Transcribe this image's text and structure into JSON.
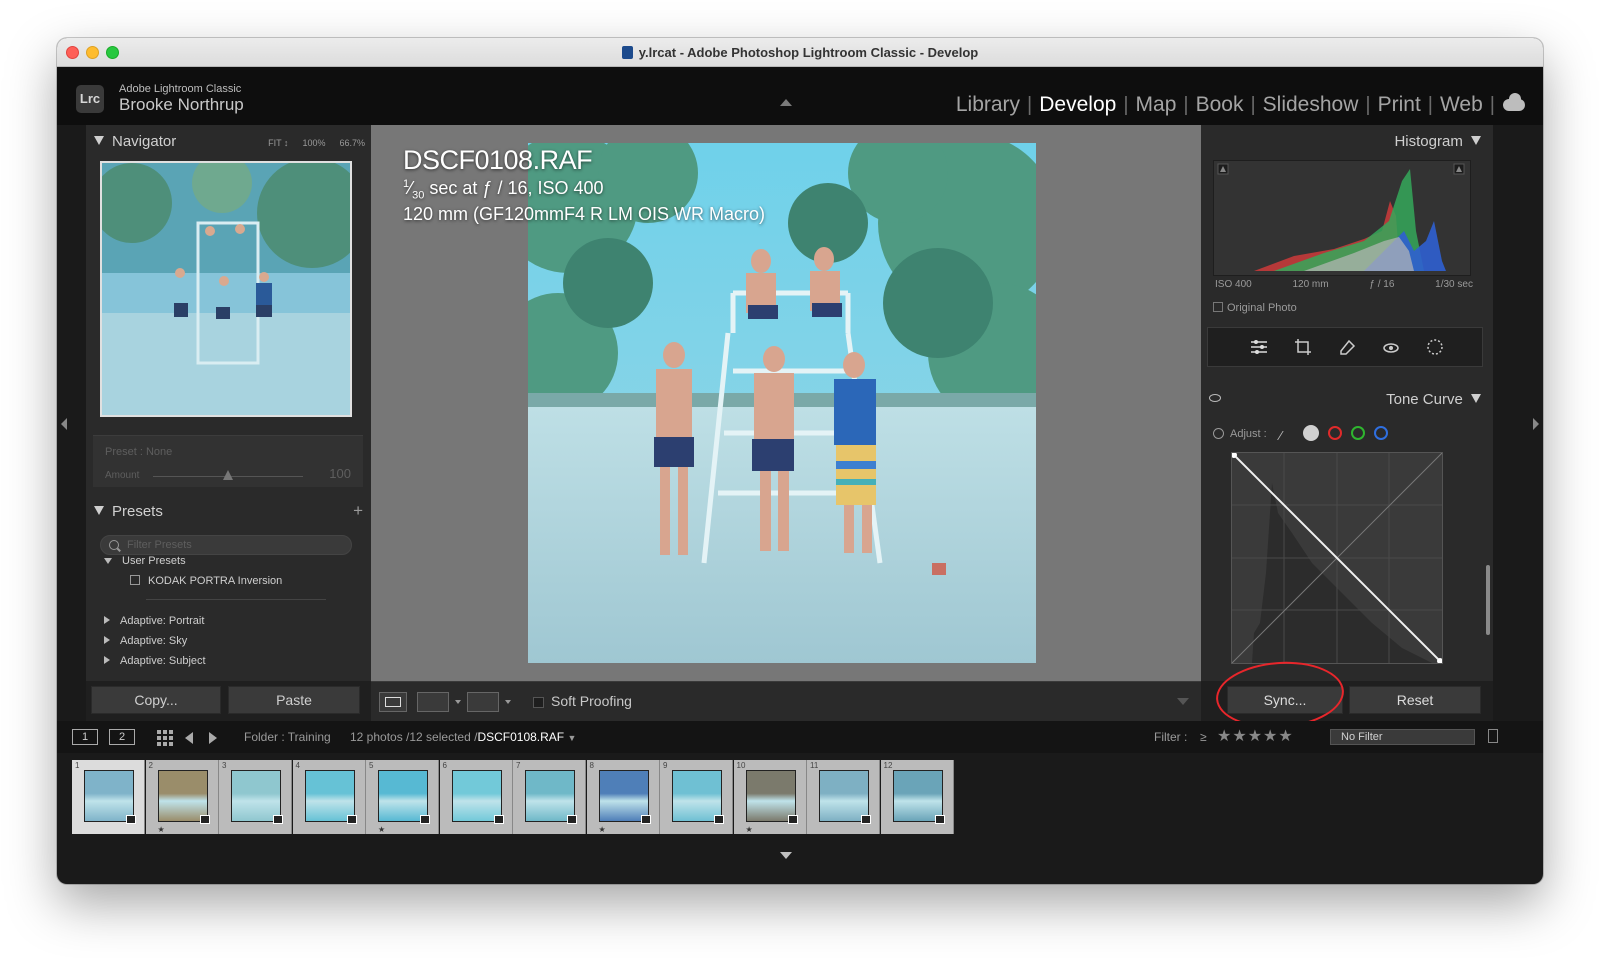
{
  "window": {
    "title": "y.lrcat - Adobe Photoshop Lightroom Classic - Develop"
  },
  "identity": {
    "logo": "Lrc",
    "app_name": "Adobe Lightroom Classic",
    "user": "Brooke Northrup"
  },
  "modules": [
    "Library",
    "Develop",
    "Map",
    "Book",
    "Slideshow",
    "Print",
    "Web"
  ],
  "active_module": "Develop",
  "navigator": {
    "title": "Navigator",
    "zoom_options": [
      "FIT ↕",
      "100%",
      "66.7%"
    ]
  },
  "preset_amount": {
    "preset_label": "Preset : None",
    "amount_label": "Amount",
    "amount_value": "100"
  },
  "presets": {
    "title": "Presets",
    "filter_placeholder": "Filter Presets",
    "groups": [
      {
        "label": "User Presets",
        "expanded": true,
        "items": [
          "KODAK PORTRA Inversion"
        ]
      },
      {
        "label": "Adaptive: Portrait"
      },
      {
        "label": "Adaptive: Sky"
      },
      {
        "label": "Adaptive: Subject"
      }
    ]
  },
  "left_buttons": {
    "copy": "Copy...",
    "paste": "Paste"
  },
  "photo_info": {
    "filename": "DSCF0108.RAF",
    "exposure": "⅔₀ sec at ƒ / 16, ISO 400",
    "exposure_numerator": "1",
    "exposure_denominator": "30",
    "exposure_rest": "sec at ƒ / 16, ISO 400",
    "lens": "120 mm (GF120mmF4 R LM OIS WR Macro)"
  },
  "toolbar": {
    "soft_proofing": "Soft Proofing"
  },
  "histogram": {
    "title": "Histogram",
    "meta": [
      "ISO 400",
      "120 mm",
      "ƒ / 16",
      "1/30 sec"
    ],
    "original_photo": "Original Photo"
  },
  "tools": [
    "edit-sliders-icon",
    "crop-icon",
    "healing-icon",
    "redeye-icon",
    "masking-icon"
  ],
  "tone_curve": {
    "title": "Tone Curve",
    "adjust_label": "Adjust :",
    "channel_colors": [
      "#cfcfcf",
      "#e02a2a",
      "#2fb52f",
      "#2f6fe0"
    ]
  },
  "right_buttons": {
    "sync": "Sync...",
    "reset": "Reset"
  },
  "filmbar": {
    "page1": "1",
    "page2": "2",
    "folder": "Folder : Training",
    "count": "12 photos /12 selected /",
    "current": "DSCF0108.RAF",
    "filter_label": "Filter :",
    "filter_op": "≥",
    "stars": "★★★★★",
    "filter_value": "No Filter"
  },
  "filmstrip": {
    "thumbnails": [
      {
        "num": "1",
        "starred": false,
        "tone": "#7fb3c9"
      },
      {
        "num": "2",
        "starred": true,
        "tone": "#9a8d6a"
      },
      {
        "num": "3",
        "starred": false,
        "tone": "#8fc7cf"
      },
      {
        "num": "4",
        "starred": false,
        "tone": "#66c2d6"
      },
      {
        "num": "5",
        "starred": true,
        "tone": "#57b9d3"
      },
      {
        "num": "6",
        "starred": false,
        "tone": "#72c9d9"
      },
      {
        "num": "7",
        "starred": false,
        "tone": "#6fb8c8"
      },
      {
        "num": "8",
        "starred": true,
        "tone": "#4f7fb8"
      },
      {
        "num": "9",
        "starred": false,
        "tone": "#6fc0d3"
      },
      {
        "num": "10",
        "starred": true,
        "tone": "#7b7a6c"
      },
      {
        "num": "11",
        "starred": false,
        "tone": "#7eb0c3"
      },
      {
        "num": "12",
        "starred": false,
        "tone": "#6aa4b8"
      }
    ]
  }
}
